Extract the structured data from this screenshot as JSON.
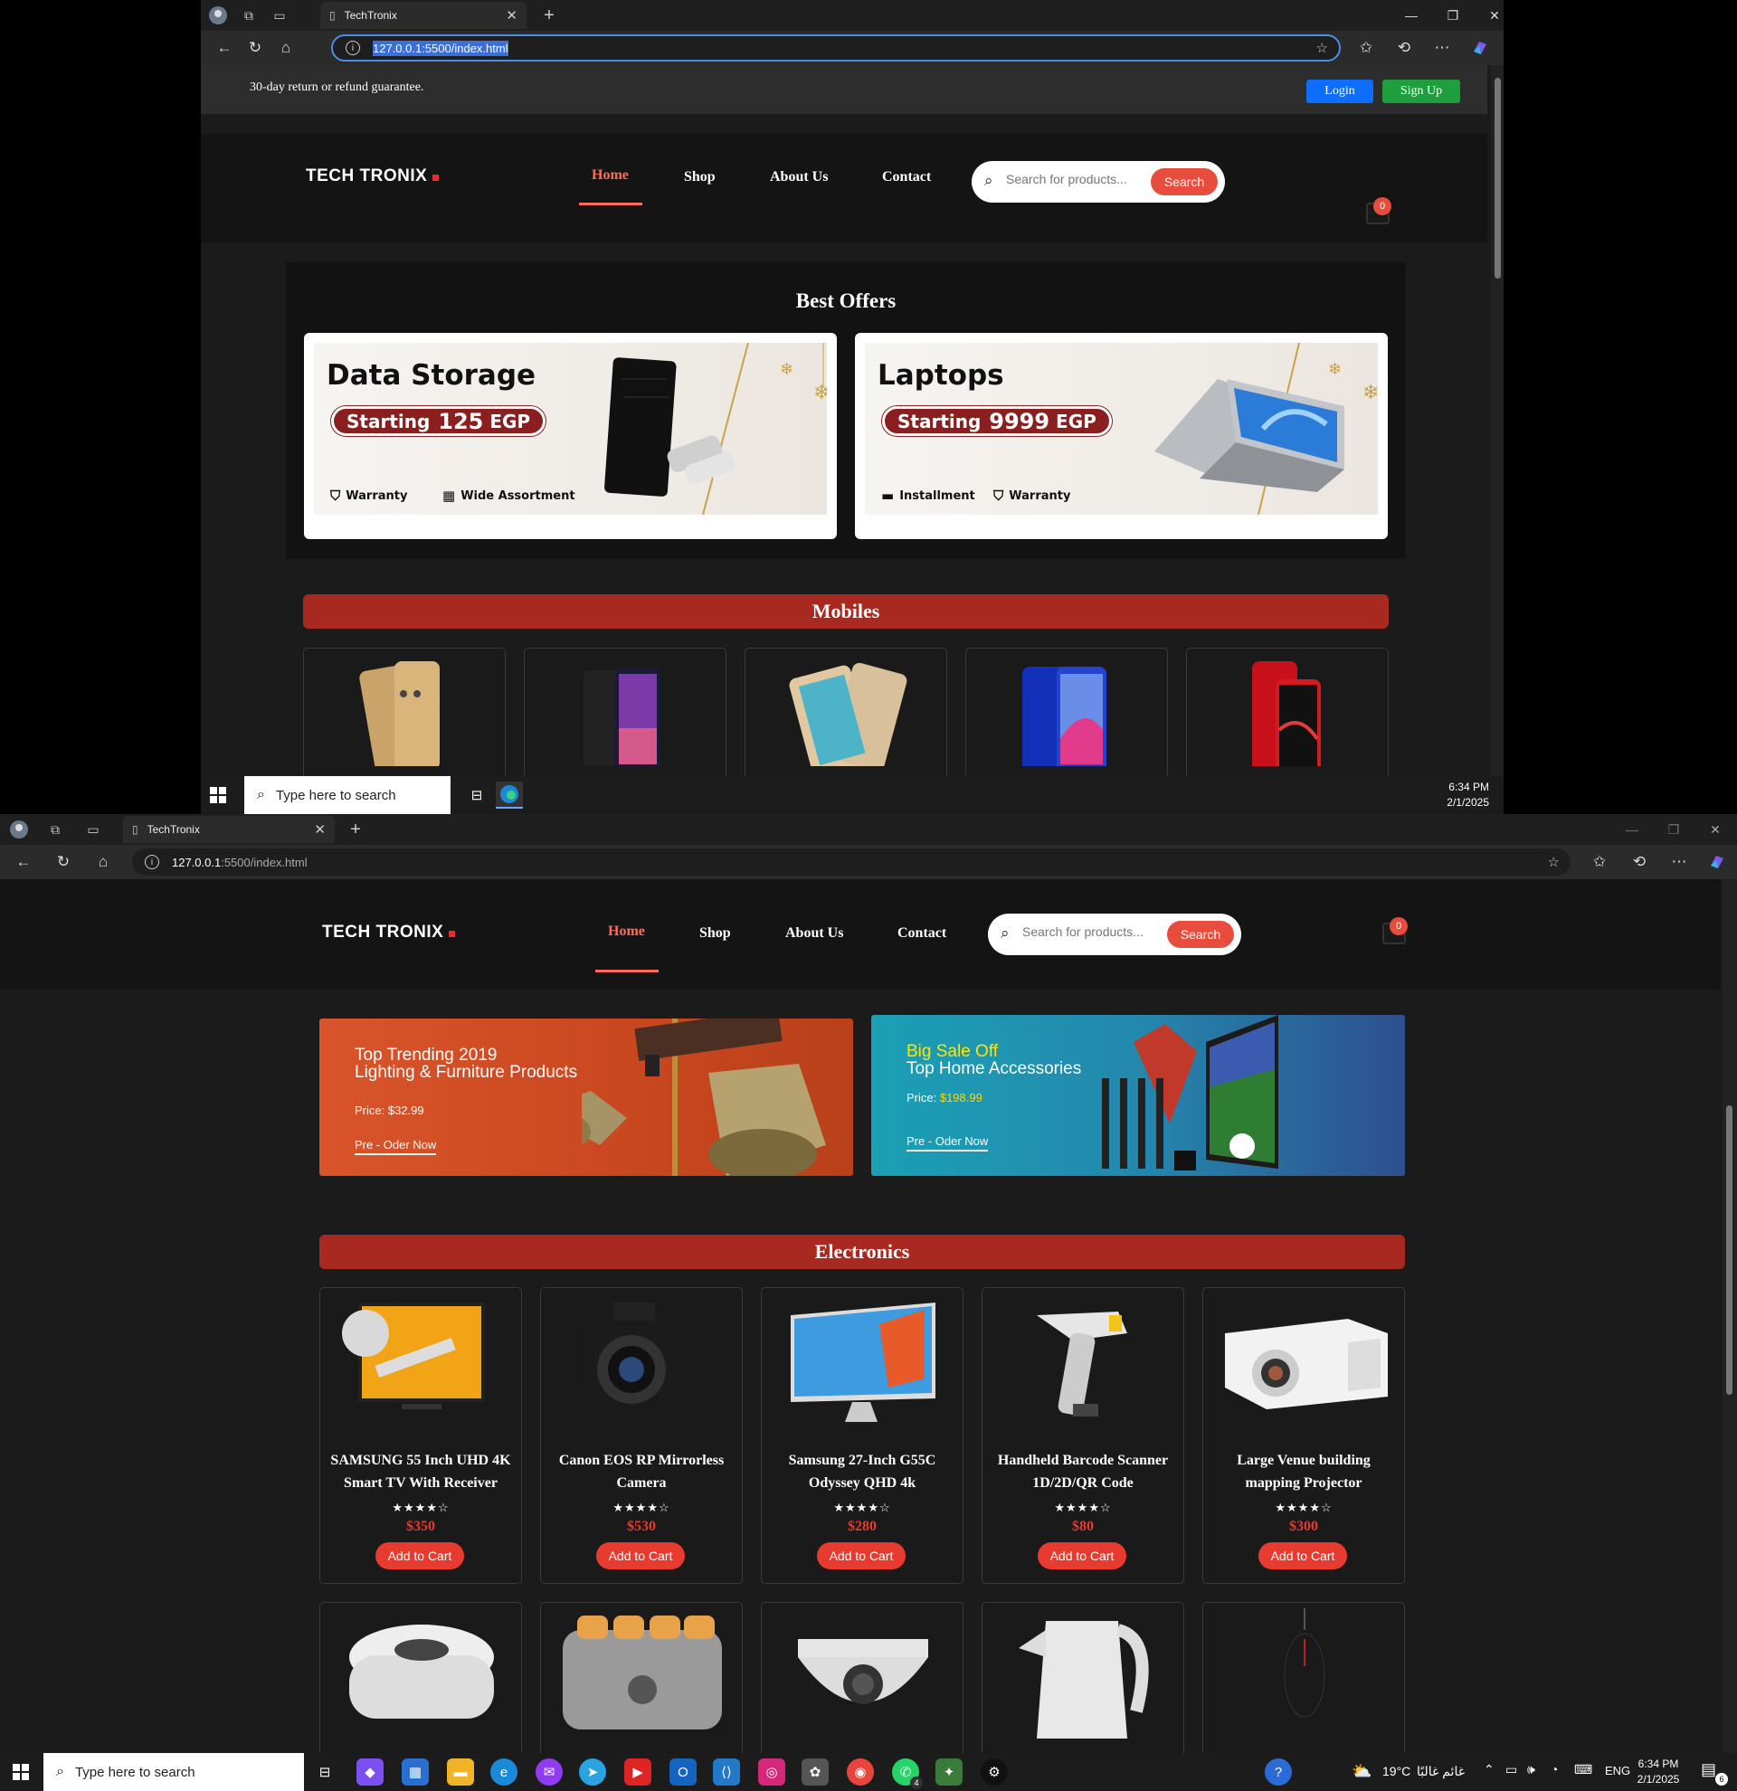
{
  "browser": {
    "tab_title": "TechTronix",
    "url": "127.0.0.1:5500/index.html",
    "url_host": "127.0.0.1",
    "url_rest": ":5500/index.html"
  },
  "topbar": {
    "notice": "30-day return or refund guarantee.",
    "login": "Login",
    "signup": "Sign Up"
  },
  "header": {
    "logo": "TECH TRONIX",
    "nav": [
      "Home",
      "Shop",
      "About Us",
      "Contact"
    ],
    "search_placeholder": "Search for products...",
    "search_button": "Search",
    "cart_count": "0"
  },
  "offers": {
    "heading": "Best Offers",
    "cards": [
      {
        "title": "Data Storage",
        "pill_prefix": "Starting",
        "pill_num": "125",
        "pill_unit": "EGP",
        "feature1": "Warranty",
        "feature2": "Wide Assortment"
      },
      {
        "title": "Laptops",
        "pill_prefix": "Starting",
        "pill_num": "9999",
        "pill_unit": "EGP",
        "feature1": "Installment",
        "feature2": "Warranty"
      }
    ]
  },
  "mobiles_heading": "Mobiles",
  "promos": [
    {
      "line1": "Top Trending 2019",
      "line2": "Lighting & Furniture Products",
      "price_label": "Price: ",
      "price": "$32.99",
      "cta": "Pre - Oder Now"
    },
    {
      "line1": "Big Sale Off",
      "line2": "Top Home Accessories",
      "price_label": "Price: ",
      "price": "$198.99",
      "cta": "Pre - Oder Now"
    }
  ],
  "electronics": {
    "heading": "Electronics",
    "add_label": "Add to Cart",
    "items": [
      {
        "name": "SAMSUNG 55 Inch UHD 4K Smart TV With Receiver",
        "stars": "★★★★☆",
        "price": "$350"
      },
      {
        "name": "Canon EOS RP Mirrorless Camera",
        "stars": "★★★★☆",
        "price": "$530"
      },
      {
        "name": "Samsung 27-Inch G55C Odyssey QHD 4k",
        "stars": "★★★★☆",
        "price": "$280"
      },
      {
        "name": "Handheld Barcode Scanner 1D/2D/QR Code",
        "stars": "★★★★☆",
        "price": "$80"
      },
      {
        "name": "Large Venue building mapping Projector",
        "stars": "★★★★☆",
        "price": "$300"
      }
    ]
  },
  "taskbar": {
    "search_placeholder": "Type here to search",
    "time": "6:34 PM",
    "date": "2/1/2025",
    "weather": "19°C",
    "weather_text": "غائم غالبًا",
    "lang": "ENG",
    "notif": "6",
    "whatsapp_badge": "4"
  }
}
